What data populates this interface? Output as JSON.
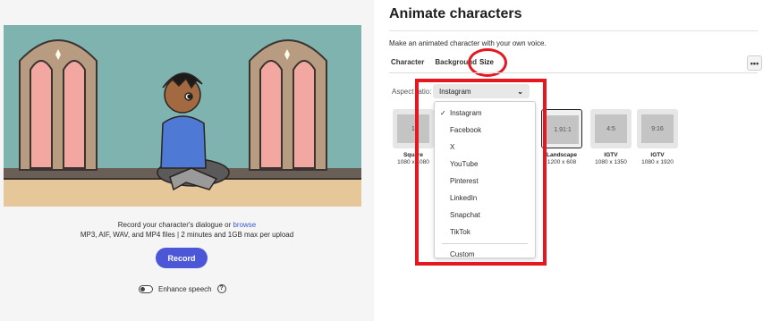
{
  "left_panel": {
    "record_line1": "Record your character's dialogue or ",
    "browse_link": "browse",
    "record_line2": "MP3, AIF, WAV, and MP4 files | 2 minutes and 1GB max per upload",
    "record_button": "Record",
    "enhance_label": "Enhance speech",
    "help_icon_text": "?"
  },
  "right_panel": {
    "title": "Animate characters",
    "subtitle": "Make an animated character with your own voice.",
    "tabs": [
      {
        "label": "Character"
      },
      {
        "label": "Background"
      },
      {
        "label": "Size"
      }
    ],
    "more_button": "•••",
    "aspect_label": "Aspect ratio:",
    "aspect_value": "Instagram",
    "dropdown_options": [
      "Instagram",
      "Facebook",
      "X",
      "YouTube",
      "Pinterest",
      "LinkedIn",
      "Snapchat",
      "TikTok",
      "Custom"
    ],
    "dropdown_checked": "Instagram",
    "cards": [
      {
        "ratio": "1",
        "name": "Square",
        "dims": "1080 x 1080"
      },
      {
        "ratio": "1.91:1",
        "name": "Landscape",
        "dims": "1200 x 608"
      },
      {
        "ratio": "4:5",
        "name": "IGTV",
        "dims": "1080 x 1350"
      },
      {
        "ratio": "9:16",
        "name": "IGTV",
        "dims": "1080 x 1920"
      }
    ]
  },
  "colors": {
    "accent": "#4b57d6",
    "highlight": "#e5171f",
    "link": "#3d5ad6",
    "scene_wall": "#7fb3b0"
  }
}
